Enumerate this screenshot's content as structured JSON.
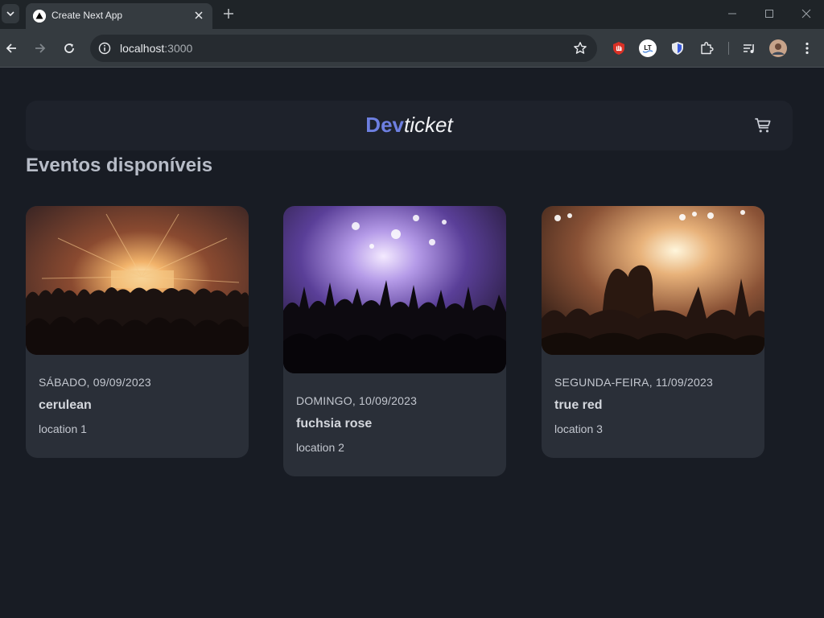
{
  "browser": {
    "tab_title": "Create Next App",
    "url_host": "localhost",
    "url_port": ":3000"
  },
  "site": {
    "logo_dev": "Dev",
    "logo_ticket": "ticket",
    "heading": "Eventos disponíveis"
  },
  "events": [
    {
      "date": "SÁBADO, 09/09/2023",
      "name": "cerulean",
      "location": "location 1"
    },
    {
      "date": "DOMINGO, 10/09/2023",
      "name": "fuchsia rose",
      "location": "location 2"
    },
    {
      "date": "SEGUNDA-FEIRA, 11/09/2023",
      "name": "true red",
      "location": "location 3"
    }
  ],
  "colors": {
    "accent": "#6d7fe0",
    "page_bg": "#181c24",
    "card_bg": "#2a2f38"
  }
}
